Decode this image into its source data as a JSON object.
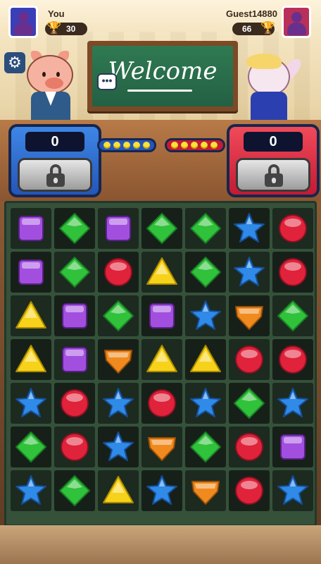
{
  "players": {
    "left": {
      "name": "You",
      "trophies": "30",
      "score": "0",
      "color": "#3a3fb8"
    },
    "right": {
      "name": "Guest14880",
      "trophies": "66",
      "score": "0",
      "color": "#b8305a"
    }
  },
  "chalkboard": {
    "text": "Welcome"
  },
  "speech_bubble": {
    "text": "•••"
  },
  "icons": {
    "settings": "gear-icon",
    "trophy": "trophy-icon",
    "lock": "lock-icon",
    "chat": "chat-bubble-icon"
  },
  "progress": {
    "left_dots": 5,
    "right_dots": 5
  },
  "gem_colors": {
    "purple-square": "#a24fe0",
    "green-diamond": "#2fc23a",
    "red-circle": "#e0223a",
    "blue-star": "#2f8ae8",
    "yellow-triangle": "#f7d21a",
    "orange-shield": "#f08a1e"
  },
  "board": {
    "rows": 7,
    "cols": 7,
    "cells": [
      [
        "purple-square",
        "green-diamond",
        "purple-square",
        "green-diamond",
        "green-diamond",
        "blue-star",
        "red-circle"
      ],
      [
        "purple-square",
        "green-diamond",
        "red-circle",
        "yellow-triangle",
        "green-diamond",
        "blue-star",
        "red-circle"
      ],
      [
        "yellow-triangle",
        "purple-square",
        "green-diamond",
        "purple-square",
        "blue-star",
        "orange-shield",
        "green-diamond"
      ],
      [
        "yellow-triangle",
        "purple-square",
        "orange-shield",
        "yellow-triangle",
        "yellow-triangle",
        "red-circle",
        "red-circle"
      ],
      [
        "blue-star",
        "red-circle",
        "blue-star",
        "red-circle",
        "blue-star",
        "green-diamond",
        "blue-star"
      ],
      [
        "green-diamond",
        "red-circle",
        "blue-star",
        "orange-shield",
        "green-diamond",
        "red-circle",
        "purple-square"
      ],
      [
        "blue-star",
        "green-diamond",
        "yellow-triangle",
        "blue-star",
        "orange-shield",
        "red-circle",
        "blue-star"
      ]
    ]
  }
}
